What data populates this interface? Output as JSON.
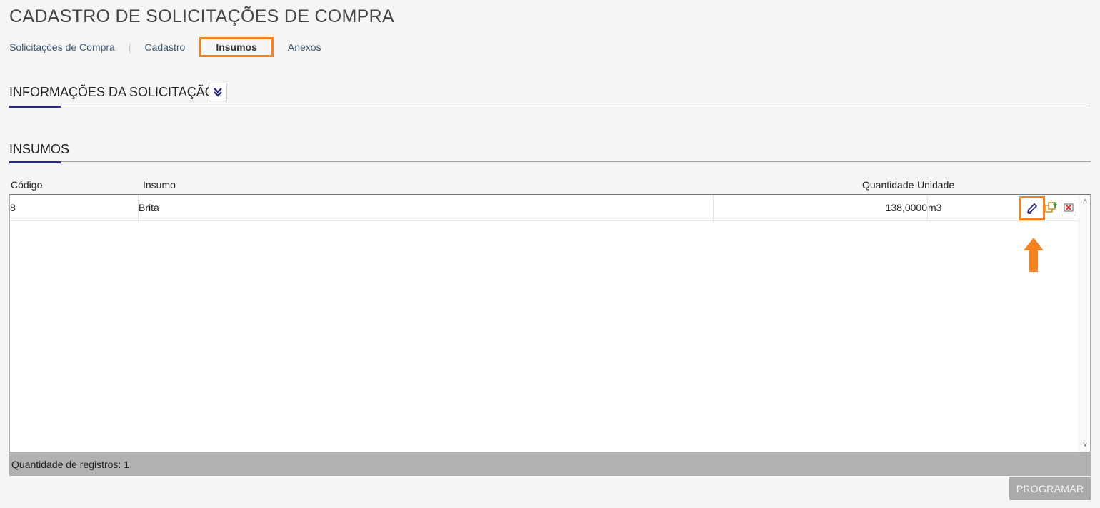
{
  "page": {
    "title": "CADASTRO DE SOLICITAÇÕES DE COMPRA"
  },
  "breadcrumb": {
    "items": [
      {
        "label": "Solicitações de Compra"
      },
      {
        "label": "Cadastro"
      },
      {
        "label": "Insumos",
        "active": true
      },
      {
        "label": "Anexos"
      }
    ]
  },
  "sections": {
    "info_title": "INFORMAÇÕES DA SOLICITAÇÃO",
    "info_toggle_icon": "double-chevron-down-icon",
    "insumos_title": "INSUMOS"
  },
  "grid": {
    "columns": [
      "Código",
      "Insumo",
      "Quantidade",
      "Unidade"
    ],
    "rows": [
      {
        "codigo": "8",
        "insumo": "Brita",
        "quantidade": "138,0000",
        "unidade": "m3"
      }
    ],
    "row_actions": [
      "edit-pencil-icon",
      "programar-icon",
      "remove-icon"
    ],
    "footer": "Quantidade de registros: 1"
  },
  "actions": {
    "programar_label": "PROGRAMAR"
  },
  "colors": {
    "accent": "#2c2a7c",
    "highlight": "#f58220",
    "footer_bg": "#b1b1b1"
  }
}
